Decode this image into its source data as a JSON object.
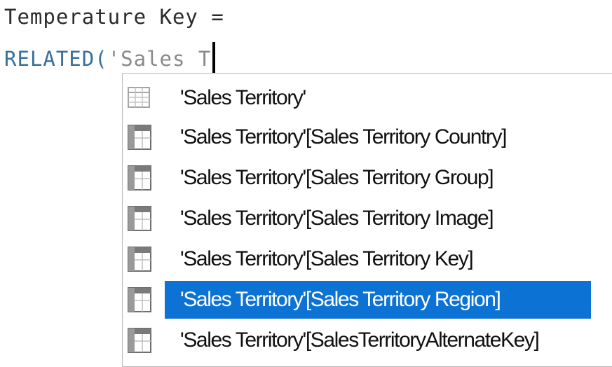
{
  "editor": {
    "line1": "Temperature Key =",
    "line2_function": "RELATED(",
    "line2_typed": "'Sales T"
  },
  "autocomplete": {
    "items": [
      {
        "label": "'Sales Territory'",
        "icon": "table-icon",
        "selected": false
      },
      {
        "label": "'Sales Territory'[Sales Territory Country]",
        "icon": "column-icon",
        "selected": false
      },
      {
        "label": "'Sales Territory'[Sales Territory Group]",
        "icon": "column-icon",
        "selected": false
      },
      {
        "label": "'Sales Territory'[Sales Territory Image]",
        "icon": "column-icon",
        "selected": false
      },
      {
        "label": "'Sales Territory'[Sales Territory Key]",
        "icon": "column-icon",
        "selected": false
      },
      {
        "label": "'Sales Territory'[Sales Territory Region]",
        "icon": "column-icon",
        "selected": true
      },
      {
        "label": "'Sales Territory'[SalesTerritoryAlternateKey]",
        "icon": "column-icon",
        "selected": false
      }
    ]
  },
  "colors": {
    "function_text": "#3a6f99",
    "string_text": "#8a8a8a",
    "selection_background": "#0c73d4",
    "selection_text": "#ffffff"
  }
}
